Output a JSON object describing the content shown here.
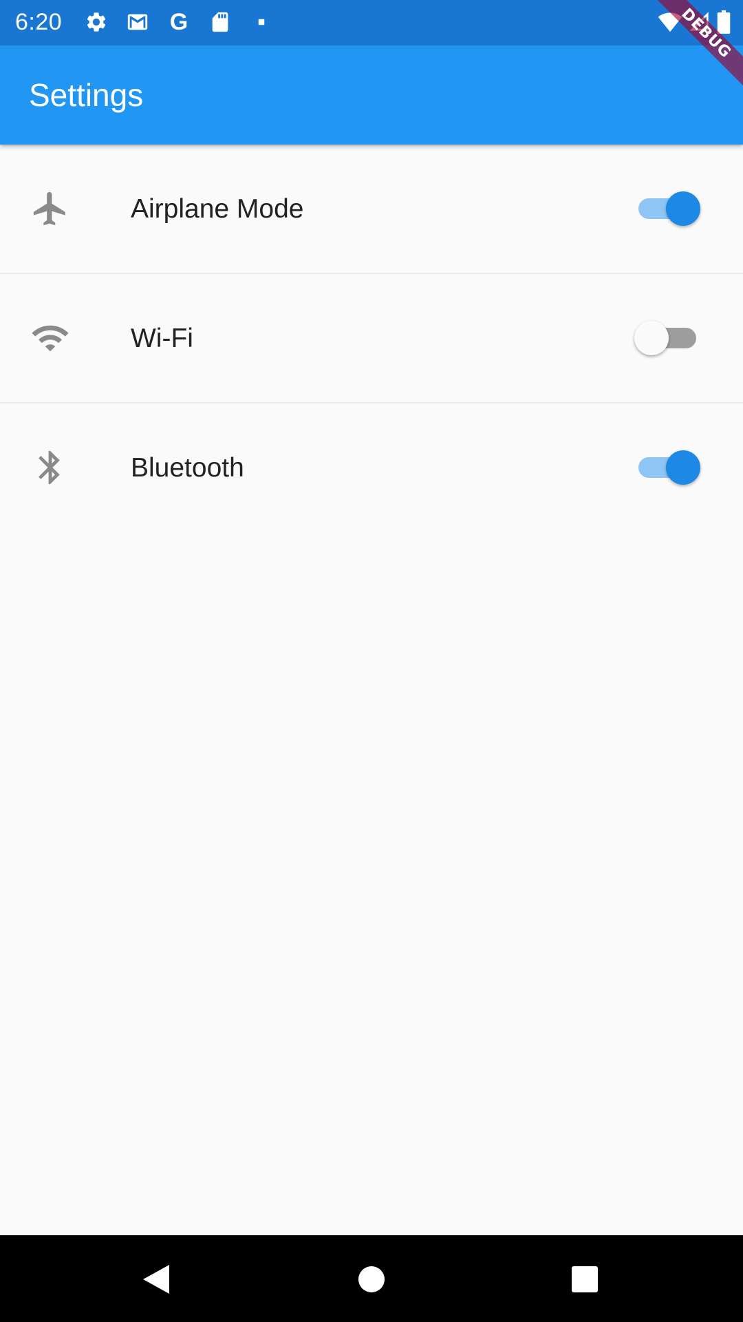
{
  "status_bar": {
    "time": "6:20",
    "left_icons": [
      "gear-icon",
      "mail-icon",
      "google-g-icon",
      "sd-card-icon",
      "dot-icon"
    ],
    "google_letter": "G",
    "right_icons": [
      "wifi-icon",
      "cell-signal-icon",
      "battery-icon"
    ]
  },
  "debug_banner": {
    "label": "DEBUG"
  },
  "app_bar": {
    "title": "Settings",
    "color": "#2196f3"
  },
  "settings": {
    "items": [
      {
        "label": "Airplane Mode",
        "icon": "airplane-icon",
        "enabled": true
      },
      {
        "label": "Wi-Fi",
        "icon": "wifi-icon",
        "enabled": false
      },
      {
        "label": "Bluetooth",
        "icon": "bluetooth-icon",
        "enabled": true
      }
    ]
  },
  "colors": {
    "status_bar": "#1976d2",
    "accent": "#1e88e5",
    "accent_track": "#8ec5f5",
    "icon_grey": "#8a8a8a",
    "background": "#fafafa"
  },
  "nav_bar": {
    "buttons": [
      "back-icon",
      "home-icon",
      "recents-icon"
    ]
  }
}
